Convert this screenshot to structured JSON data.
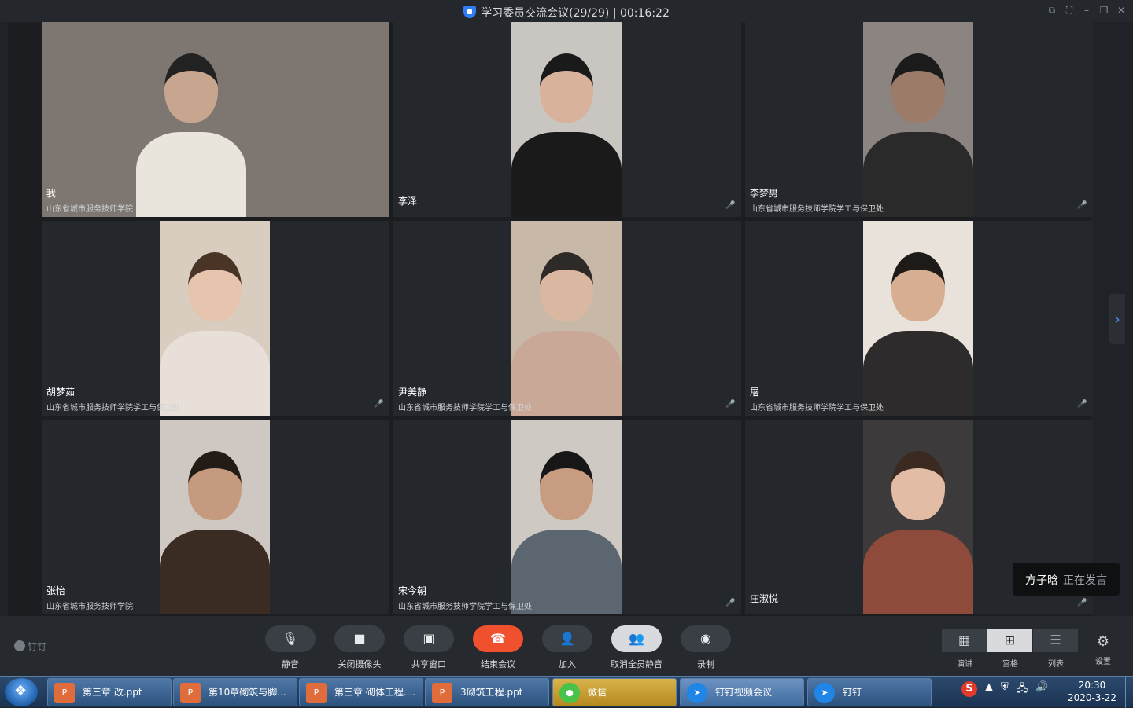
{
  "window": {
    "title": "学习委员交流会议(29/29) | 00:16:22"
  },
  "tiles": [
    {
      "name": "我",
      "org": "山东省城市服务技师学院",
      "video": "wide",
      "mic": false,
      "colors": {
        "bg": "#7e7771",
        "shirt": "#e9e5dc",
        "skin": "#c8a58e",
        "hair": "#222"
      }
    },
    {
      "name": "李泽",
      "org": "",
      "video": "mid",
      "mic": true,
      "colors": {
        "bg": "#c9c6c2",
        "shirt": "#1a1a1a",
        "skin": "#d8b29b",
        "hair": "#1a1a1a"
      }
    },
    {
      "name": "李梦男",
      "org": "山东省城市服务技师学院学工与保卫处",
      "video": "mid",
      "mic": true,
      "colors": {
        "bg": "#8c8480",
        "shirt": "#2a2a2a",
        "skin": "#9c7c68",
        "hair": "#1b1b1b"
      }
    },
    {
      "name": "胡梦茹",
      "org": "山东省城市服务技师学院学工与保卫处",
      "video": "mid",
      "mic": true,
      "colors": {
        "bg": "#d9cdbf",
        "shirt": "#e8e0d8",
        "skin": "#e6c4ae",
        "hair": "#4a3426"
      }
    },
    {
      "name": "尹美静",
      "org": "山东省城市服务技师学院学工与保卫处",
      "video": "mid",
      "mic": true,
      "colors": {
        "bg": "#c8b8a8",
        "shirt": "#caa897",
        "skin": "#d9b7a1",
        "hair": "#2e2a28"
      }
    },
    {
      "name": "屠",
      "org": "山东省城市服务技师学院学工与保卫处",
      "video": "mid",
      "mic": true,
      "colors": {
        "bg": "#e9e2da",
        "shirt": "#2d2b2b",
        "skin": "#d8ae93",
        "hair": "#1e1a18"
      }
    },
    {
      "name": "张怡",
      "org": "山东省城市服务技师学院",
      "video": "mid",
      "mic": false,
      "colors": {
        "bg": "#cfc8c2",
        "shirt": "#3a2c22",
        "skin": "#c59a7f",
        "hair": "#231b16"
      }
    },
    {
      "name": "宋今朝",
      "org": "山东省城市服务技师学院学工与保卫处",
      "video": "mid",
      "mic": true,
      "colors": {
        "bg": "#cfc9c3",
        "shirt": "#5c6670",
        "skin": "#c79c80",
        "hair": "#181616"
      }
    },
    {
      "name": "庄淑悦",
      "org": "",
      "video": "mid",
      "mic": true,
      "colors": {
        "bg": "#3c3a3a",
        "shirt": "#8e4a3a",
        "skin": "#e2bca5",
        "hair": "#3a2a22"
      }
    }
  ],
  "speaking": {
    "name": "方子晗",
    "status": "正在发言"
  },
  "brand": "钉钉",
  "toolbar": {
    "mute": "静音",
    "camera_off": "关闭摄像头",
    "share": "共享窗口",
    "end": "结束会议",
    "add": "加入",
    "unmute_all": "取消全员静音",
    "record": "录制",
    "views": [
      "演讲",
      "宫格",
      "列表"
    ],
    "settings": "设置"
  },
  "taskbar": {
    "items": [
      {
        "label": "第三章 改.ppt",
        "type": "ppt"
      },
      {
        "label": "第10章砌筑与脚...",
        "type": "ppt"
      },
      {
        "label": "第三章 砌体工程....",
        "type": "ppt"
      },
      {
        "label": "3砌筑工程.ppt",
        "type": "ppt"
      },
      {
        "label": "微信",
        "type": "wechat"
      },
      {
        "label": "钉钉视频会议",
        "type": "dingvideo"
      },
      {
        "label": "钉钉",
        "type": "ding"
      }
    ],
    "time": "20:30",
    "date": "2020-3-22"
  }
}
